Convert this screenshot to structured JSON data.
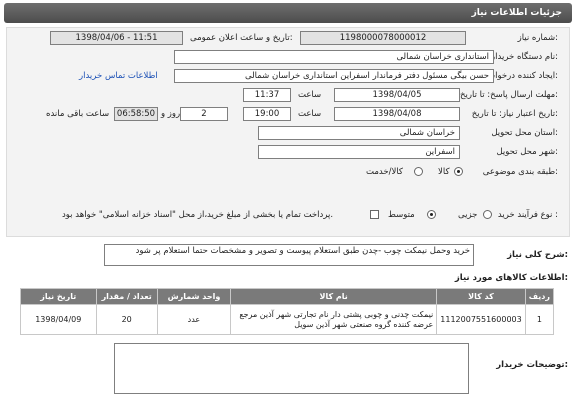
{
  "header": {
    "title": "جزئیات اطلاعات نیاز"
  },
  "form": {
    "need_number_label": "شماره نیاز:",
    "need_number": "1198000078000012",
    "announce_label": "تاریخ و ساعت اعلان عمومی:",
    "announce_value": "1398/04/06 - 11:51",
    "buyer_org_label": "نام دستگاه خریدار:",
    "buyer_org": "استانداری خراسان شمالی",
    "creator_label": "ایجاد کننده درخواست:",
    "creator": "حسن بیگی مسئول دفتر فرماندار اسفراین استانداری خراسان شمالی",
    "contact_link": "اطلاعات تماس خریدار",
    "deadline_label": "مهلت ارسال پاسخ: تا تاریخ:",
    "deadline_date": "1398/04/05",
    "time_word": "ساعت",
    "deadline_time": "11:37",
    "validity_label": "تاریخ اعتبار نیاز: تا تاریخ:",
    "validity_date": "1398/04/08",
    "validity_time": "19:00",
    "days_value": "2",
    "days_suffix": "روز و",
    "remaining_time": "06:58:50",
    "remaining_suffix": "ساعت باقی مانده",
    "province_label": "استان محل تحویل:",
    "province": "خراسان شمالی",
    "city_label": "شهر محل تحویل:",
    "city": "اسفراین",
    "category_label": "طبقه بندی موضوعی:",
    "category_options": [
      "کالا",
      "کالا/خدمت"
    ],
    "process_label": "نوع فرآیند خرید :",
    "process_options": [
      "جزیی",
      "متوسط"
    ],
    "payment_note": "پرداخت تمام یا بخشی از مبلغ خرید،از محل \"اسناد خزانه اسلامی\" خواهد بود."
  },
  "general_desc": {
    "label": "شرح کلی نیاز:",
    "text": "خرید وحمل نیمکت چوب -چدن طبق استعلام پیوست و تصویر و مشخصات حتما استعلام پر شود"
  },
  "goods": {
    "label": "اطلاعات کالاهای مورد نیاز:",
    "columns": [
      "ردیف",
      "کد کالا",
      "نام کالا",
      "واحد شمارش",
      "تعداد / مقدار",
      "تاریخ نیاز"
    ],
    "rows": [
      {
        "index": "1",
        "code": "1112007551600003",
        "name": "نیمکت چدنی و چوبی پشتی دار نام تجارتی شهر آذین مرجع عرضه کننده گروه صنعتی شهر آذین سویل",
        "unit": "عدد",
        "qty": "20",
        "date": "1398/04/09"
      }
    ]
  },
  "buyer_notes": {
    "label": "توضیحات خریدار:"
  }
}
